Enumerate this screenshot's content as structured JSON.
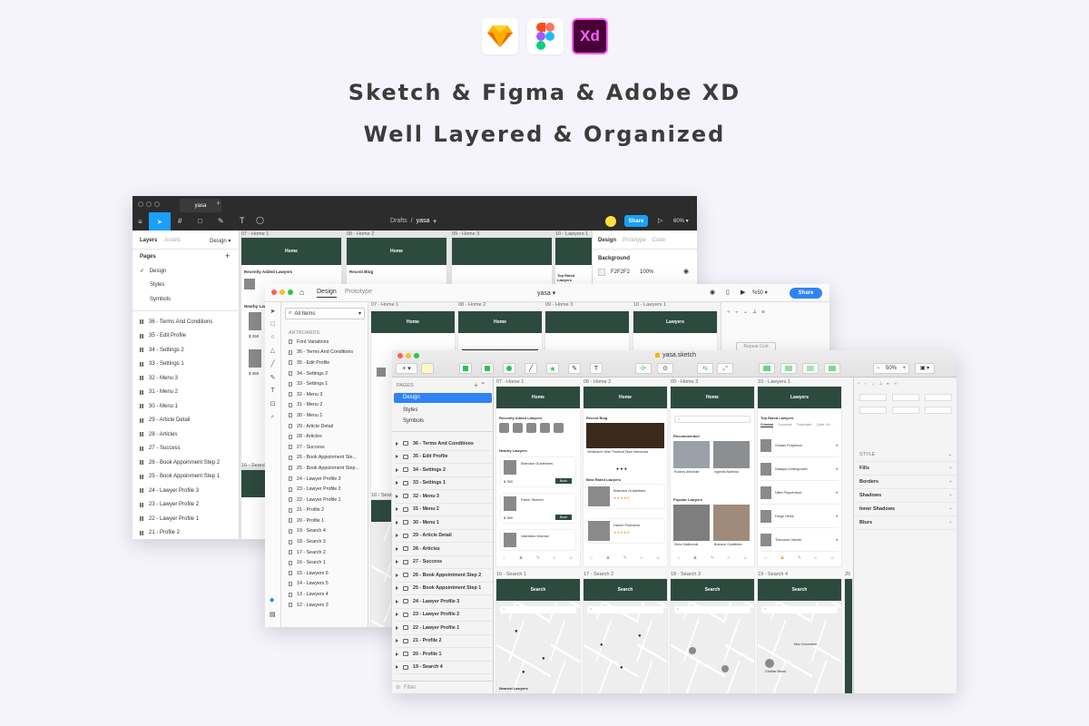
{
  "hero": {
    "line1": "Sketch & Figma & Adobe XD",
    "line2": "Well Layered & Organized",
    "xd_logo_text": "Xd"
  },
  "figma": {
    "tab_title": "yasa",
    "breadcrumb_root": "Drafts",
    "breadcrumb_sep": "/",
    "breadcrumb_file": "yasa",
    "share_label": "Share",
    "zoom": "60%",
    "panel_tabs": [
      "Layers",
      "Assets"
    ],
    "page_dropdown": "Design",
    "pages_header": "Pages",
    "pages": [
      "Design",
      "Styles",
      "Symbols"
    ],
    "layers": [
      "36 - Terms And Conditions",
      "35 - Edit Profile",
      "34 - Settings 2",
      "33 - Settings 1",
      "32 - Menu 3",
      "31 - Menu 2",
      "30 - Menu 1",
      "29 - Article Detail",
      "28 - Articles",
      "27 - Success",
      "26 - Book Appoinment Step 2",
      "25 - Book Appoinment Step 1",
      "24 - Lawyer Profile 3",
      "23 - Lawyer Profile 2",
      "22 - Lawyer Profile 1",
      "21 - Profile 2"
    ],
    "board_labels": [
      "07 - Home 1",
      "08 - Home 2",
      "09 - Home 3",
      "10 - Lawyers 1",
      "16 - Search"
    ],
    "board_titles": [
      "Home",
      "Home"
    ],
    "board_section_1": "Recently Added Lawyers",
    "board_section_2": "Recent Blog",
    "board_section_3": "Top Rated Lawyers",
    "board_section_4": "Nearby Law",
    "prices": [
      "$ 350",
      "$ 350"
    ],
    "inspector_tabs": [
      "Design",
      "Prototype",
      "Code"
    ],
    "background_label": "Background",
    "background_hex": "F2F2F2",
    "background_opacity": "100%"
  },
  "xd": {
    "tabs": [
      "Design",
      "Prototype"
    ],
    "file_title": "yasa",
    "zoom": "%50",
    "share_label": "Share",
    "search_placeholder": "All Items",
    "artboards_header": "ARTBOARDS",
    "artboards": [
      "Font Variations",
      "36 - Terms And Conditions",
      "35 - Edit Profile",
      "34 - Settings 2",
      "33 - Settings 1",
      "32 - Menu 3",
      "31 - Menu 2",
      "30 - Menu 1",
      "29 - Article Detail",
      "28 - Articles",
      "27 - Success",
      "26 - Book Appoinment Ste...",
      "25 - Book Appoinment Step...",
      "24 - Lawyer Profile 3",
      "23 - Lawyer Profile 2",
      "22 - Lawyer Profile 1",
      "21 - Profile 2",
      "20 - Profile 1",
      "19 - Search 4",
      "18 - Search 3",
      "17 - Search 2",
      "16 - Search 1",
      "15 - Lawyers 6",
      "14 - Lawyers 5",
      "13 - Lawyers 4",
      "12 - Lawyers 3"
    ],
    "board_labels": [
      "07 - Home 1",
      "08 - Home 2",
      "09 - Home 3",
      "10 - Lawyers 1",
      "16 - Search"
    ],
    "board_titles": [
      "Home",
      "Home",
      "Lawyers"
    ],
    "repeat_grid": "Repeat Grid"
  },
  "sketch": {
    "title": "yasa.sketch",
    "zoom": "50%",
    "pages_header": "PAGES",
    "pages": [
      "Design",
      "Styles",
      "Symbols"
    ],
    "layers": [
      "36 - Terms And Conditions",
      "35 - Edit Profile",
      "34 - Settings 2",
      "33 - Settings 1",
      "32 - Menu 3",
      "31 - Menu 2",
      "30 - Menu 1",
      "29 - Article Detail",
      "28 - Articles",
      "27 - Success",
      "26 - Book Appointment Step 2",
      "25 - Book Appointment Step 1",
      "24 - Lawyer Profile 3",
      "23 - Lawyer Profile 2",
      "22 - Lawyer Profile 1",
      "21 - Profile 2",
      "20 - Profile 1",
      "19 - Search 4"
    ],
    "filter_placeholder": "Filter",
    "board_labels": [
      "07 - Home 1",
      "08 - Home 2",
      "09 - Home 3",
      "10 - Lawyers 1",
      "16 - Search 1",
      "17 - Search 2",
      "18 - Search 3",
      "19 - Search 4",
      "20"
    ],
    "board_titles": [
      "Home",
      "Home",
      "Home",
      "Lawyers",
      "Search",
      "Search",
      "Search",
      "Search"
    ],
    "section_recent_lawyers": "Recently Added Lawyers",
    "section_recent_blog": "Recent Blog",
    "section_recommended": "Recommended",
    "section_top_rated": "Top Rated Lawyers",
    "section_nearby": "Nearby Lawyers",
    "section_best_rated": "Best Rated Lawyers",
    "section_popular": "Popular Lawyers",
    "section_nearest": "Nearest Lawyers",
    "lawyer_names": [
      "Brandon Guidelines",
      "Patch Skinner",
      "Valentino Morose"
    ],
    "blog_title": "Vestibulum Vitae Tincidunt Diam Maecenas",
    "best_names": [
      "Brandon Guidelines",
      "Daniel Pushkers"
    ],
    "popular_names": [
      "Dinko Malinovski",
      "Brandon Guidelines"
    ],
    "rec_names": [
      "Rodney Artichoke",
      "Ingredia Nutrisha"
    ],
    "lawyer_tabs": [
      "Criminal",
      "Corporate",
      "Trademark",
      "Cyber Cri..."
    ],
    "top_names": [
      "Gustav Purpleson",
      "Natalya Undergrowth",
      "Niles Peppertrout",
      "Diego Hinds",
      "Theodore Handle"
    ],
    "map_names": [
      "Max Conversion",
      "Gunther Beard"
    ],
    "book_label": "Book",
    "price_label": "$ 350",
    "inspector_style": "STYLE",
    "inspector_items": [
      "Fills",
      "Borders",
      "Shadows",
      "Inner Shadows",
      "Blurs"
    ]
  }
}
